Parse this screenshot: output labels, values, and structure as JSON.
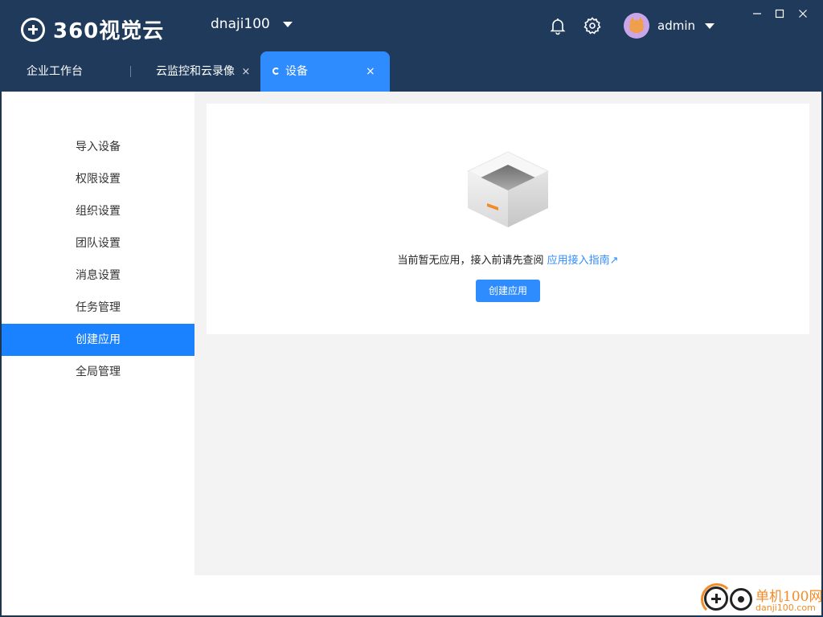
{
  "app": {
    "logo_text": "360视觉云",
    "account_name": "dnaji100",
    "user_name": "admin"
  },
  "window_controls": {
    "minimize": "—",
    "maximize": "☐",
    "close": "✕"
  },
  "tabs": [
    {
      "label": "企业工作台",
      "closable": false,
      "active": false
    },
    {
      "label": "云监控和云录像",
      "close": "×",
      "active": false
    },
    {
      "label": "设备",
      "close": "×",
      "active": true
    }
  ],
  "sidebar": {
    "items": [
      {
        "label": "导入设备",
        "active": false
      },
      {
        "label": "权限设置",
        "active": false
      },
      {
        "label": "组织设置",
        "active": false
      },
      {
        "label": "团队设置",
        "active": false
      },
      {
        "label": "消息设置",
        "active": false
      },
      {
        "label": "任务管理",
        "active": false
      },
      {
        "label": "创建应用",
        "active": true
      },
      {
        "label": "全局管理",
        "active": false
      }
    ]
  },
  "main": {
    "empty_message": "当前暂无应用，接入前请先查阅",
    "guide_link": "应用接入指南",
    "guide_link_arrow": "↗",
    "create_button": "创建应用"
  },
  "watermark": {
    "cn_text": "单机100网",
    "url": "danji100.com"
  },
  "colors": {
    "header_bg": "#1f3a5a",
    "accent": "#2f8cff",
    "sidebar_active": "#1a82ff",
    "content_bg": "#f3f3f4",
    "watermark": "#f28c28"
  }
}
